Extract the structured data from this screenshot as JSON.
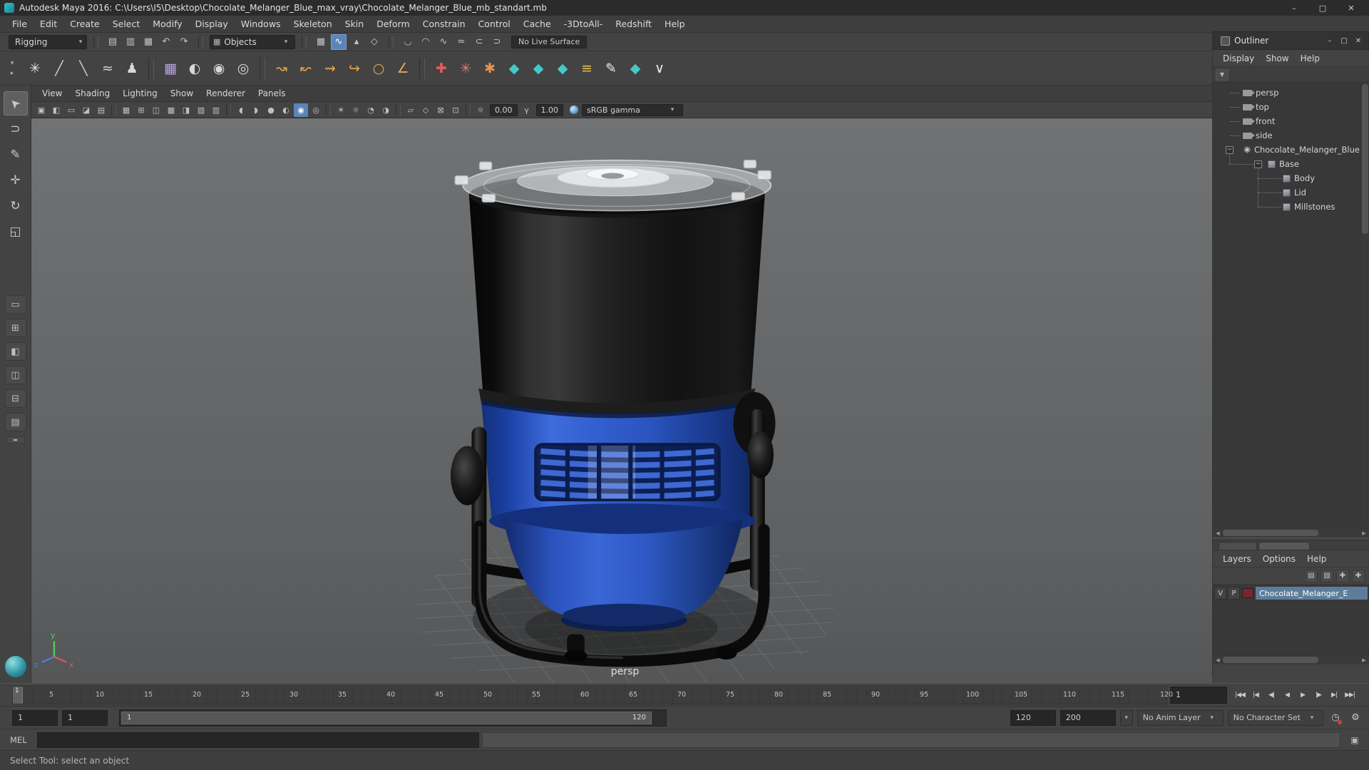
{
  "titlebar": {
    "title": "Autodesk Maya 2016: C:\\Users\\I5\\Desktop\\Chocolate_Melanger_Blue_max_vray\\Chocolate_Melanger_Blue_mb_standart.mb",
    "minimize": "–",
    "maximize": "□",
    "close": "✕"
  },
  "menubar": {
    "items": [
      "File",
      "Edit",
      "Create",
      "Select",
      "Modify",
      "Display",
      "Windows",
      "Skeleton",
      "Skin",
      "Deform",
      "Constrain",
      "Control",
      "Cache",
      "-3DtoAll-",
      "Redshift",
      "Help"
    ]
  },
  "statusline": {
    "menu_set": "Rigging",
    "arrow": "▾",
    "file_icons": [
      {
        "glyph": "▤"
      },
      {
        "glyph": "▥"
      },
      {
        "glyph": "▦"
      }
    ],
    "history_icons": [
      {
        "glyph": "↶"
      },
      {
        "glyph": "↷"
      }
    ],
    "selection_mask": {
      "icon": "▦",
      "label": "Objects",
      "arrow": "▾"
    },
    "snap_icons": [
      {
        "glyph": "▦"
      },
      {
        "glyph": "∿"
      },
      {
        "glyph": "▴"
      },
      {
        "glyph": "◇"
      }
    ],
    "tool_icons": [
      {
        "glyph": "◡"
      },
      {
        "glyph": "◠"
      },
      {
        "glyph": "∿"
      },
      {
        "glyph": "≈"
      },
      {
        "glyph": "⊂"
      },
      {
        "glyph": "⊃"
      }
    ],
    "live_surface": "No Live Surface",
    "accent_color": "#5b84b8"
  },
  "shelf": {
    "switcher": [
      "▾",
      "▸"
    ],
    "icons": [
      {
        "glyph": "✳",
        "color": "#e4e4e4"
      },
      {
        "glyph": "╱",
        "color": "#cfcfcf"
      },
      {
        "glyph": "╲",
        "color": "#cfcfcf"
      },
      {
        "glyph": "≈",
        "color": "#cfcfcf"
      },
      {
        "glyph": "♟",
        "color": "#d8d8d8"
      },
      {
        "glyph": "▦",
        "color": "#b9a6e0"
      },
      {
        "glyph": "◐",
        "color": "#d8d8d8"
      },
      {
        "glyph": "◉",
        "color": "#d8d8d8"
      },
      {
        "glyph": "◎",
        "color": "#d8d8d8"
      },
      {
        "glyph": "↝",
        "color": "#e8a84e"
      },
      {
        "glyph": "↜",
        "color": "#e8a84e"
      },
      {
        "glyph": "⇝",
        "color": "#e8a84e"
      },
      {
        "glyph": "↪",
        "color": "#e8a84e"
      },
      {
        "glyph": "○",
        "color": "#e8a84e"
      },
      {
        "glyph": "∠",
        "color": "#e8a84e"
      },
      {
        "glyph": "✚",
        "color": "#e05c5c"
      },
      {
        "glyph": "✳",
        "color": "#e07a7a"
      },
      {
        "glyph": "✱",
        "color": "#e8954e"
      },
      {
        "glyph": "◆",
        "color": "#46c8c8"
      },
      {
        "glyph": "◆",
        "color": "#46c8c8"
      },
      {
        "glyph": "◆",
        "color": "#46c8c8"
      },
      {
        "glyph": "≡",
        "color": "#e0c050"
      },
      {
        "glyph": "✎",
        "color": "#ececec"
      },
      {
        "glyph": "◆",
        "color": "#46c8c8"
      },
      {
        "glyph": "∨",
        "color": "#ececec"
      }
    ]
  },
  "toolbox": {
    "tools": [
      {
        "glyph": "➤"
      },
      {
        "glyph": "⊃"
      },
      {
        "glyph": "✎"
      },
      {
        "glyph": "✛"
      },
      {
        "glyph": "↻"
      },
      {
        "glyph": "◱"
      }
    ],
    "layouts": [
      {
        "glyph": "▭"
      },
      {
        "glyph": "⊞"
      },
      {
        "glyph": "◧"
      },
      {
        "glyph": "◫"
      },
      {
        "glyph": "⊟"
      },
      {
        "glyph": "▤"
      }
    ],
    "mini": "▬"
  },
  "panelmenu": {
    "items": [
      "View",
      "Shading",
      "Lighting",
      "Show",
      "Renderer",
      "Panels"
    ]
  },
  "viewbar": {
    "group1": [
      {
        "glyph": "▣"
      },
      {
        "glyph": "◧"
      },
      {
        "glyph": "▭"
      },
      {
        "glyph": "◪"
      },
      {
        "glyph": "▤"
      }
    ],
    "group2": [
      {
        "glyph": "▦"
      },
      {
        "glyph": "⊞"
      },
      {
        "glyph": "◫"
      },
      {
        "glyph": "▩"
      },
      {
        "glyph": "◨"
      },
      {
        "glyph": "▧"
      },
      {
        "glyph": "▥"
      }
    ],
    "group3": [
      {
        "glyph": "◖"
      },
      {
        "glyph": "◗"
      },
      {
        "glyph": "●"
      },
      {
        "glyph": "◐"
      },
      {
        "glyph": "◉"
      },
      {
        "glyph": "◎"
      }
    ],
    "group4": [
      {
        "glyph": "☀"
      },
      {
        "glyph": "☼"
      },
      {
        "glyph": "◔"
      },
      {
        "glyph": "◑"
      }
    ],
    "group5": [
      {
        "glyph": "▱"
      },
      {
        "glyph": "◇"
      },
      {
        "glyph": "⊠"
      },
      {
        "glyph": "⊡"
      }
    ],
    "exposure_icon": "☼",
    "exposure": "0.00",
    "gamma_icon": "γ",
    "gamma": "1.00",
    "colorspace": "sRGB gamma",
    "arrow": "▾"
  },
  "viewport": {
    "camera_label": "persp",
    "axis": {
      "x": "x",
      "y": "y",
      "z": "z"
    }
  },
  "outliner": {
    "title": "Outliner",
    "buttons": {
      "min": "–",
      "max": "□",
      "close": "✕"
    },
    "menus": [
      "Display",
      "Show",
      "Help"
    ],
    "filter_icon": "▼",
    "cameras": [
      "persp",
      "top",
      "front",
      "side"
    ],
    "root": {
      "expander": "−",
      "label": "Chocolate_Melanger_Blue_n"
    },
    "group": {
      "expander": "−",
      "label": "Base"
    },
    "children": [
      "Body",
      "Lid",
      "Millstones"
    ],
    "scroll": {
      "left": "◀",
      "right": "▶"
    }
  },
  "layers": {
    "menus": [
      "Layers",
      "Options",
      "Help"
    ],
    "icons": [
      {
        "glyph": "▤"
      },
      {
        "glyph": "▧"
      },
      {
        "glyph": "✚"
      },
      {
        "glyph": "✚"
      }
    ],
    "row": {
      "v": "V",
      "p": "P",
      "swatch_color": "#7a2430",
      "name": "Chocolate_Melanger_E",
      "name_bg": "#5d7d9c"
    },
    "scroll": {
      "left": "◀",
      "right": "▶"
    }
  },
  "timeline": {
    "current_frame": "1",
    "ticks": [
      "5",
      "10",
      "15",
      "20",
      "25",
      "30",
      "35",
      "40",
      "45",
      "50",
      "55",
      "60",
      "65",
      "70",
      "75",
      "80",
      "85",
      "90",
      "95",
      "100",
      "105",
      "110",
      "115",
      "120"
    ],
    "time_field": "1",
    "playback": [
      {
        "glyph": "|◀◀"
      },
      {
        "glyph": "|◀"
      },
      {
        "glyph": "◀|"
      },
      {
        "glyph": "◀"
      },
      {
        "glyph": "▶"
      },
      {
        "glyph": "|▶"
      },
      {
        "glyph": "▶|"
      },
      {
        "glyph": "▶▶|"
      }
    ]
  },
  "rangeslider": {
    "anim_start": "1",
    "play_start": "1",
    "bar_start": "1",
    "bar_end": "120",
    "play_end": "120",
    "anim_end": "200",
    "options_arrow": "▾",
    "anim_layer": "No Anim Layer",
    "character_set": "No Character Set",
    "autokey_icon": "◷",
    "prefs_icon": "⚙"
  },
  "commandline": {
    "label": "MEL",
    "icon": "▣"
  },
  "helpline": {
    "text": "Select Tool: select an object"
  }
}
